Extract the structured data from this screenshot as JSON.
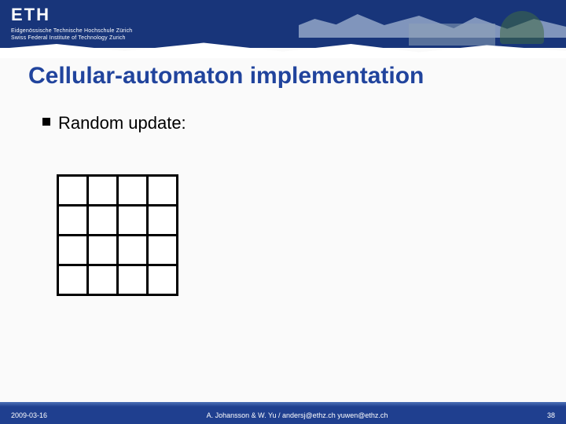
{
  "header": {
    "logo_text": "ETH",
    "subtitle_line1": "Eidgenössische Technische Hochschule Zürich",
    "subtitle_line2": "Swiss Federal Institute of Technology Zurich"
  },
  "title": "Cellular-automaton implementation",
  "bullet": "Random update:",
  "grid": {
    "rows": 4,
    "cols": 4
  },
  "footer": {
    "date": "2009-03-16",
    "center": "A. Johansson & W. Yu  /  andersj@ethz.ch yuwen@ethz.ch",
    "page": "38"
  }
}
